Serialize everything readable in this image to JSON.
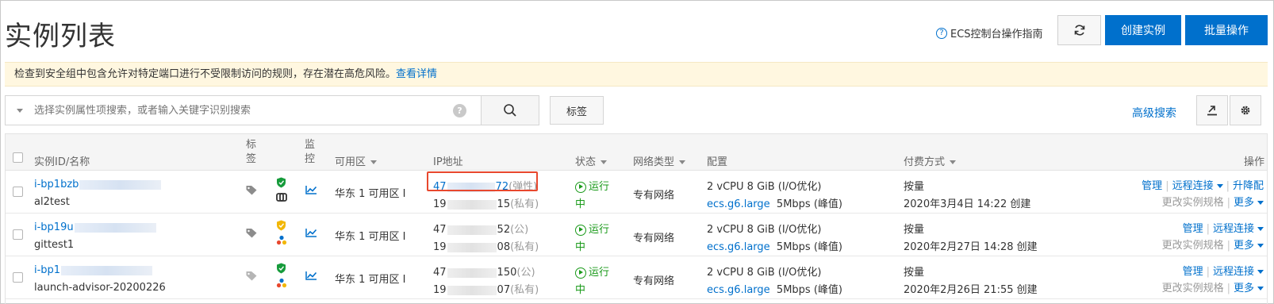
{
  "page": {
    "title": "实例列表"
  },
  "header": {
    "guide_label": "ECS控制台操作指南",
    "create_label": "创建实例",
    "batch_label": "批量操作"
  },
  "alert": {
    "text": "检查到安全组中包含允许对特定端口进行不受限制访问的规则，存在潜在高危风险。",
    "link": "查看详情"
  },
  "search": {
    "placeholder": "选择实例属性项搜索，或者输入关键字识别搜索",
    "tag_label": "标签",
    "advanced_label": "高级搜索"
  },
  "table": {
    "headers": {
      "id": "实例ID/名称",
      "tag": "标签",
      "monitor": "监控",
      "zone": "可用区",
      "ip": "IP地址",
      "status": "状态",
      "network": "网络类型",
      "config": "配置",
      "billing": "付费方式",
      "actions": "操作"
    },
    "rows": [
      {
        "id_prefix": "i-bp1bzb",
        "name": "al2test",
        "zone": "华东 1 可用区 I",
        "ip1_prefix": "47",
        "ip1_suffix": "72",
        "ip1_type": "(弹性)",
        "ip2_prefix": "19",
        "ip2_suffix": "15",
        "ip2_type": "(私有)",
        "status_1": "运行",
        "status_2": "中",
        "network": "专有网络",
        "config_spec": "2 vCPU 8 GiB (I/O优化)",
        "config_type": "ecs.g6.large",
        "bandwidth": "5Mbps (峰值)",
        "billing": "按量",
        "created": "2020年3月4日 14:22 创建",
        "act_manage": "管理",
        "act_remote": "远程连接",
        "act_upgrade": "升降配",
        "act_change": "更改实例规格",
        "act_more": "更多"
      },
      {
        "id_prefix": "i-bp19u",
        "name": "gittest1",
        "zone": "华东 1 可用区 I",
        "ip1_prefix": "47",
        "ip1_suffix": "52",
        "ip1_type": "(公)",
        "ip2_prefix": "19",
        "ip2_suffix": "08",
        "ip2_type": "(私有)",
        "status_1": "运行",
        "status_2": "中",
        "network": "专有网络",
        "config_spec": "2 vCPU 8 GiB (I/O优化)",
        "config_type": "ecs.g6.large",
        "bandwidth": "5Mbps (峰值)",
        "billing": "按量",
        "created": "2020年2月27日 14:28 创建",
        "act_manage": "管理",
        "act_remote": "远程连接",
        "act_change": "更改实例规格",
        "act_more": "更多"
      },
      {
        "id_prefix": "i-bp1",
        "name": "launch-advisor-20200226",
        "zone": "华东 1 可用区 I",
        "ip1_prefix": "47",
        "ip1_suffix": "150",
        "ip1_type": "(公)",
        "ip2_prefix": "19",
        "ip2_suffix": "07",
        "ip2_type": "(私有)",
        "status_1": "运行",
        "status_2": "中",
        "network": "专有网络",
        "config_spec": "2 vCPU 8 GiB (I/O优化)",
        "config_type": "ecs.g6.large",
        "bandwidth": "5Mbps (峰值)",
        "billing": "按量",
        "created": "2020年2月26日 21:55 创建",
        "act_manage": "管理",
        "act_remote": "远程连接",
        "act_change": "更改实例规格",
        "act_more": "更多"
      }
    ]
  },
  "colors": {
    "primary": "#0070cc",
    "alert_bg": "#fff7e0",
    "running": "#1a9a1a",
    "highlight": "#e8482e"
  }
}
